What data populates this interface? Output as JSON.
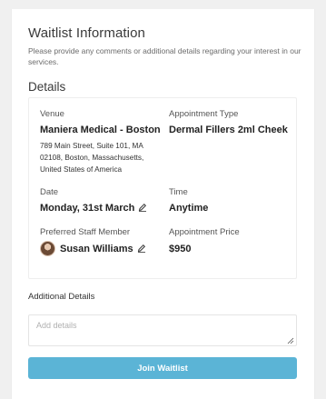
{
  "header": {
    "title": "Waitlist Information",
    "subtitle": "Please provide any comments or additional details regarding your interest in our services."
  },
  "details": {
    "title": "Details",
    "venue": {
      "label": "Venue",
      "name": "Maniera Medical - Boston",
      "address": "789 Main Street, Suite 101, MA 02108, Boston, Massachusetts, United States of America"
    },
    "appointment_type": {
      "label": "Appointment Type",
      "value": "Dermal Fillers 2ml Cheek"
    },
    "date": {
      "label": "Date",
      "value": "Monday, 31st March"
    },
    "time": {
      "label": "Time",
      "value": "Anytime"
    },
    "staff": {
      "label": "Preferred Staff Member",
      "value": "Susan Williams"
    },
    "price": {
      "label": "Appointment Price",
      "value": "$950"
    }
  },
  "additional": {
    "label": "Additional Details",
    "placeholder": "Add details",
    "value": ""
  },
  "actions": {
    "join_label": "Join Waitlist"
  },
  "colors": {
    "button": "#5bb4d6",
    "background": "#f0f0f0"
  },
  "icons": {
    "edit": "pencil-icon",
    "avatar": "staff-avatar"
  }
}
